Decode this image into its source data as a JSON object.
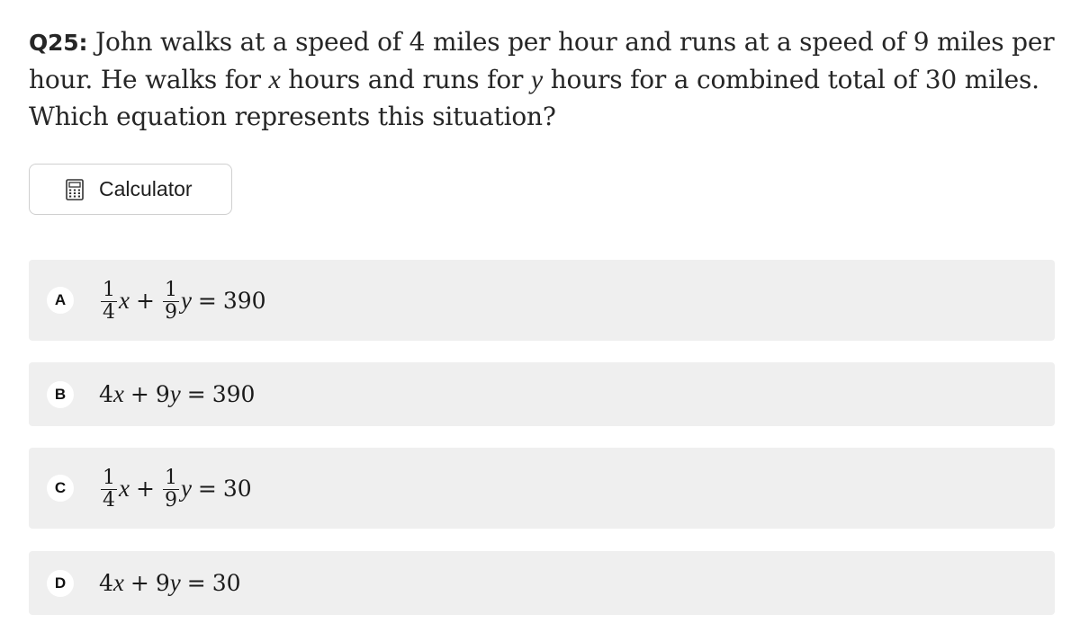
{
  "question": {
    "number": "Q25:",
    "text_part1": " John walks at a speed of 4 miles per hour and runs at a speed of 9 miles per hour. He walks for ",
    "var_x": "x",
    "text_part2": " hours and runs for ",
    "var_y": "y",
    "text_part3": " hours for a combined total of 30 miles. Which equation represents this situation?"
  },
  "calculator": {
    "label": "Calculator",
    "icon": "calculator-icon"
  },
  "options": [
    {
      "letter": "A",
      "frac1_num": "1",
      "frac1_den": "4",
      "var1": "x",
      "plus": "+",
      "frac2_num": "1",
      "frac2_den": "9",
      "var2": "y",
      "equals": "=",
      "rhs": "390"
    },
    {
      "letter": "B",
      "coef1": "4",
      "var1": "x",
      "plus": "+",
      "coef2": "9",
      "var2": "y",
      "equals": "=",
      "rhs": "390"
    },
    {
      "letter": "C",
      "frac1_num": "1",
      "frac1_den": "4",
      "var1": "x",
      "plus": "+",
      "frac2_num": "1",
      "frac2_den": "9",
      "var2": "y",
      "equals": "=",
      "rhs": "30"
    },
    {
      "letter": "D",
      "coef1": "4",
      "var1": "x",
      "plus": "+",
      "coef2": "9",
      "var2": "y",
      "equals": "=",
      "rhs": "30"
    }
  ],
  "colors": {
    "option_background": "#efefef",
    "badge_background": "#ffffff",
    "text": "#222222"
  }
}
